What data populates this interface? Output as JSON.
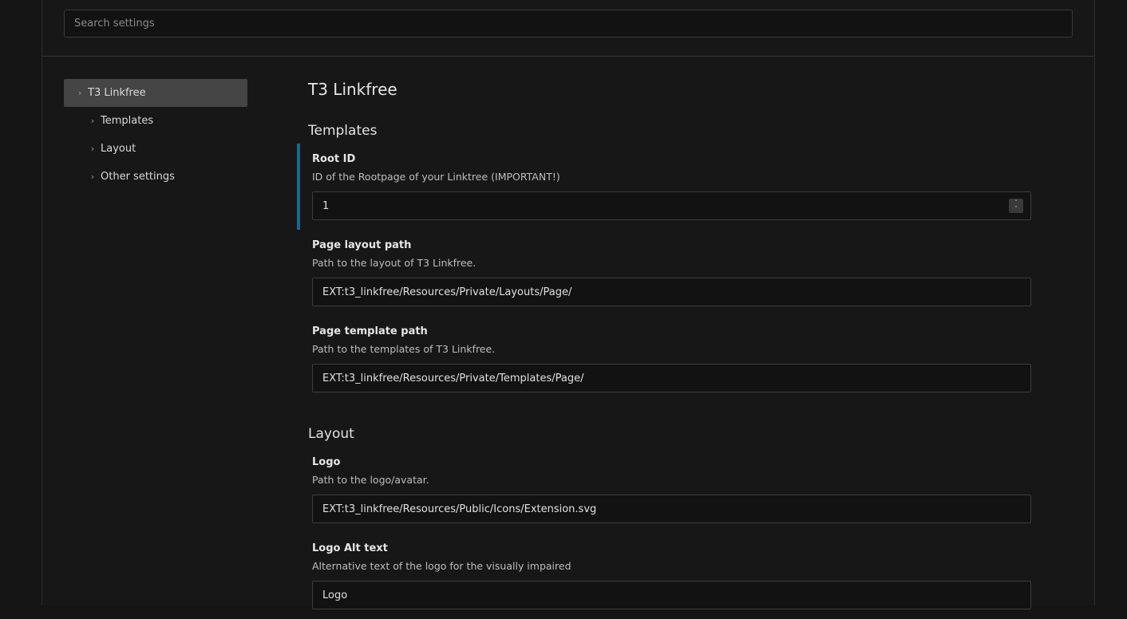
{
  "search": {
    "placeholder": "Search settings"
  },
  "tree": [
    {
      "label": "T3 Linkfree",
      "level": 0,
      "active": true
    },
    {
      "label": "Templates",
      "level": 1
    },
    {
      "label": "Layout",
      "level": 1
    },
    {
      "label": "Other settings",
      "level": 1
    }
  ],
  "main": {
    "title": "T3 Linkfree",
    "sections": [
      {
        "title": "Templates",
        "settings": [
          {
            "label": "Root ID",
            "description": "ID of the Rootpage of your Linktree (IMPORTANT!)",
            "value": "1"
          },
          {
            "label": "Page layout path",
            "description": "Path to the layout of T3 Linkfree.",
            "value": "EXT:t3_linkfree/Resources/Private/Layouts/Page/"
          },
          {
            "label": "Page template path",
            "description": "Path to the templates of T3 Linkfree.",
            "value": "EXT:t3_linkfree/Resources/Private/Templates/Page/"
          }
        ]
      },
      {
        "title": "Layout",
        "settings": [
          {
            "label": "Logo",
            "description": "Path to the logo/avatar.",
            "value": "EXT:t3_linkfree/Resources/Public/Icons/Extension.svg"
          },
          {
            "label": "Logo Alt text",
            "description": "Alternative text of the logo for the visually impaired",
            "value": "Logo"
          }
        ]
      }
    ]
  },
  "colors": {
    "accent": "#1b6a8e",
    "active_item_bg": "#454545",
    "background": "#171717"
  },
  "icons": {
    "tree_chevron": "chevron-right-icon",
    "number_spinner": "spinner-icon"
  }
}
